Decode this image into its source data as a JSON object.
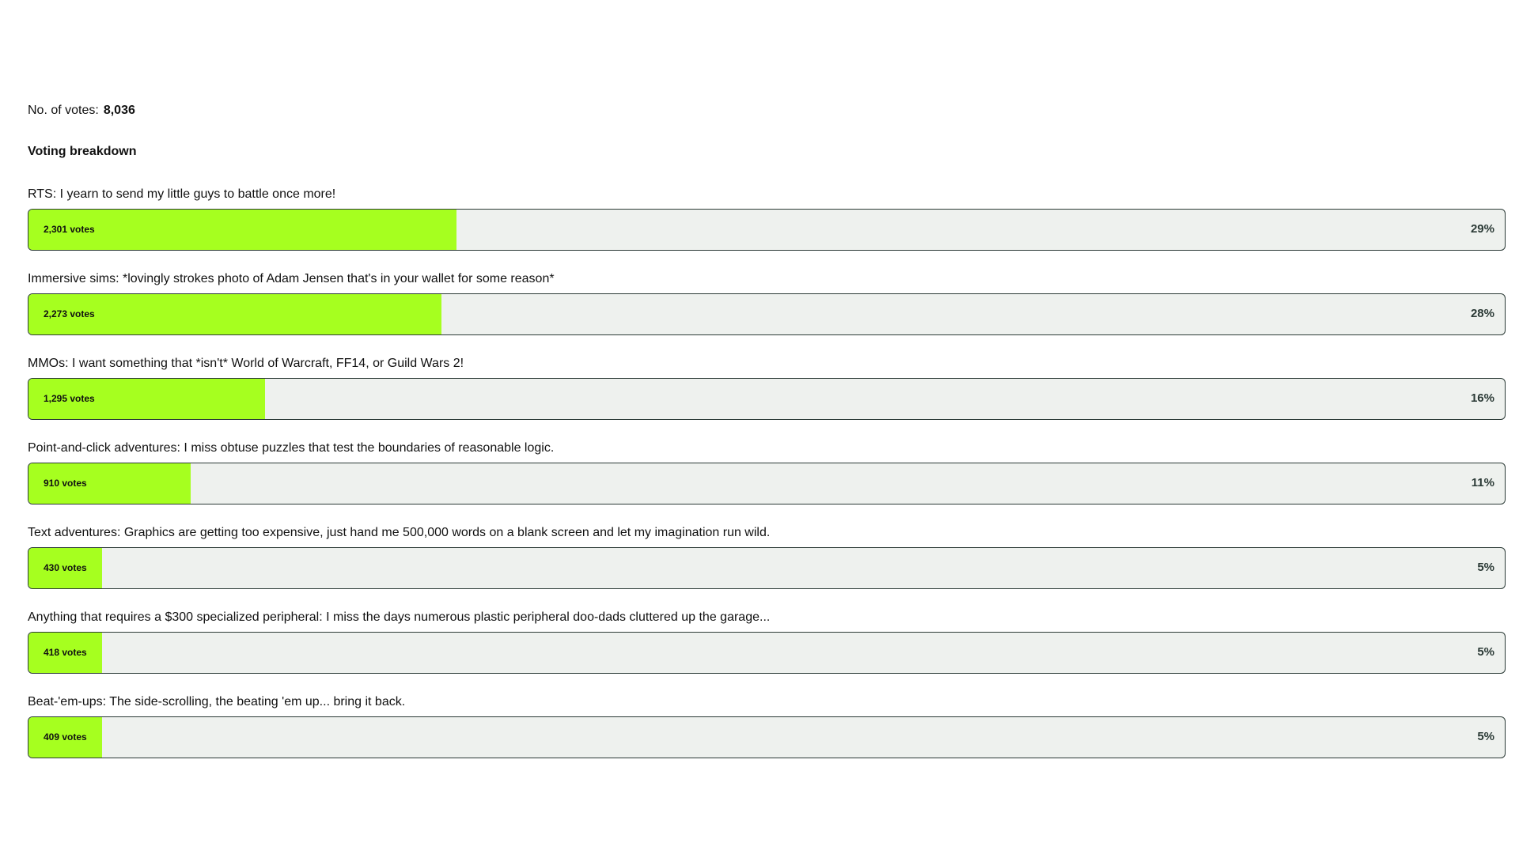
{
  "poll": {
    "total_label": "No. of votes:",
    "total_value": "8,036",
    "breakdown_heading": "Voting breakdown",
    "accent_color": "#a6ff1f",
    "options": [
      {
        "label": "RTS: I yearn to send my little guys to battle once more!",
        "votes": "2,301 votes",
        "percent_text": "29%",
        "percent": 29
      },
      {
        "label": "Immersive sims: *lovingly strokes photo of Adam Jensen that's in your wallet for some reason*",
        "votes": "2,273 votes",
        "percent_text": "28%",
        "percent": 28
      },
      {
        "label": "MMOs: I want something that *isn't* World of Warcraft, FF14, or Guild Wars 2!",
        "votes": "1,295 votes",
        "percent_text": "16%",
        "percent": 16
      },
      {
        "label": "Point-and-click adventures: I miss obtuse puzzles that test the boundaries of reasonable logic.",
        "votes": "910 votes",
        "percent_text": "11%",
        "percent": 11
      },
      {
        "label": "Text adventures: Graphics are getting too expensive, just hand me 500,000 words on a blank screen and let my imagination run wild.",
        "votes": "430 votes",
        "percent_text": "5%",
        "percent": 5
      },
      {
        "label": "Anything that requires a $300 specialized peripheral: I miss the days numerous plastic peripheral doo-dads cluttered up the garage...",
        "votes": "418 votes",
        "percent_text": "5%",
        "percent": 5
      },
      {
        "label": "Beat-'em-ups: The side-scrolling, the beating 'em up... bring it back.",
        "votes": "409 votes",
        "percent_text": "5%",
        "percent": 5
      }
    ]
  }
}
